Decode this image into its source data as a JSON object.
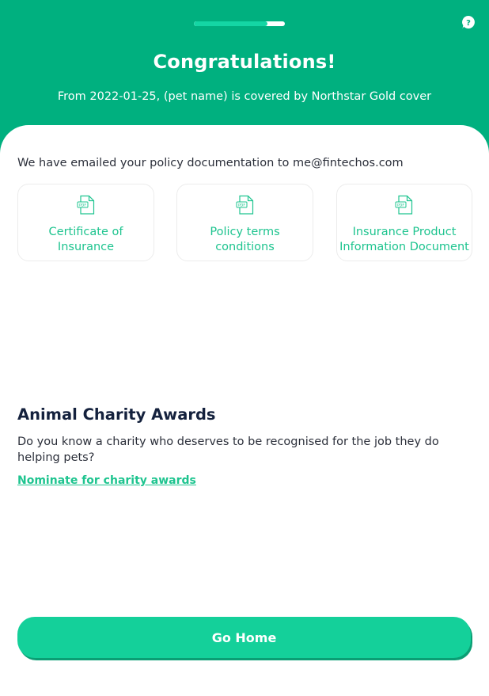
{
  "header": {
    "title": "Congratulations!",
    "subtitle": "From 2022-01-25, (pet name) is covered by Northstar Gold cover",
    "progress_fraction": 0.81,
    "help_icon": "help-icon"
  },
  "documents": {
    "intro": "We have emailed your policy documentation to me@fintechos.com",
    "icon": "pdf-icon",
    "items": [
      {
        "label": "Certificate of Insurance"
      },
      {
        "label": "Policy terms conditions"
      },
      {
        "label": "Insurance Product Information Document"
      }
    ]
  },
  "charity": {
    "title": "Animal Charity Awards",
    "text": "Do you know a charity who deserves to be recognised for the job they do helping pets?",
    "link": "Nominate for charity awards"
  },
  "footer": {
    "button_label": "Go Home"
  },
  "colors": {
    "brand": "#00b07f",
    "accent": "#14d09a",
    "link": "#1ec48f"
  }
}
